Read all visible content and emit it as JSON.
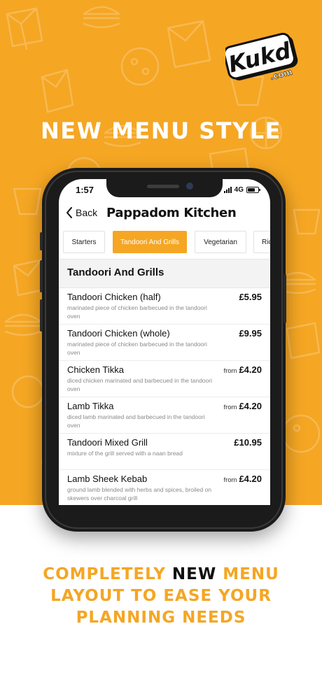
{
  "colors": {
    "brand": "#f5a623",
    "text_dark": "#111111",
    "text_muted": "#8a8a8a",
    "white": "#ffffff"
  },
  "logo": {
    "text": "Kukd",
    "suffix": ".com"
  },
  "hero": {
    "title": "NEW MENU STYLE"
  },
  "status_bar": {
    "time": "1:57",
    "network": "4G",
    "battery_level": 0.7
  },
  "nav": {
    "back_label": "Back",
    "title": "Pappadom Kitchen"
  },
  "tabs": [
    {
      "label": "Starters",
      "active": false
    },
    {
      "label": "Tandoori And Grills",
      "active": true
    },
    {
      "label": "Vegetarian",
      "active": false
    },
    {
      "label": "Rice",
      "active": false
    }
  ],
  "section": {
    "title": "Tandoori And Grills"
  },
  "menu_items": [
    {
      "name": "Tandoori Chicken (half)",
      "description": "marinated piece of chicken barbecued in the tandoori oven",
      "from": "",
      "price": "£5.95"
    },
    {
      "name": "Tandoori Chicken (whole)",
      "description": "marinated piece of chicken barbecued in the tandoori oven",
      "from": "",
      "price": "£9.95"
    },
    {
      "name": "Chicken Tikka",
      "description": "diced chicken marinated and barbecued in the tandoori oven",
      "from": "from",
      "price": "£4.20"
    },
    {
      "name": "Lamb Tikka",
      "description": "diced lamb marinated and barbecued in the tandoori oven",
      "from": "from",
      "price": "£4.20"
    },
    {
      "name": "Tandoori Mixed Grill",
      "description": "mixture of the grill served with a naan bread",
      "from": "",
      "price": "£10.95"
    },
    {
      "name": "Lamb Sheek Kebab",
      "description": "ground lamb blended with herbs and spices, broiled on skewers over charcoal grill",
      "from": "from",
      "price": "£4.20"
    }
  ],
  "tagline": {
    "part1": "COMPLETELY ",
    "highlight": "NEW",
    "part2": " MENU",
    "line2": "LAYOUT TO EASE YOUR",
    "line3": "PLANNING NEEDS"
  }
}
